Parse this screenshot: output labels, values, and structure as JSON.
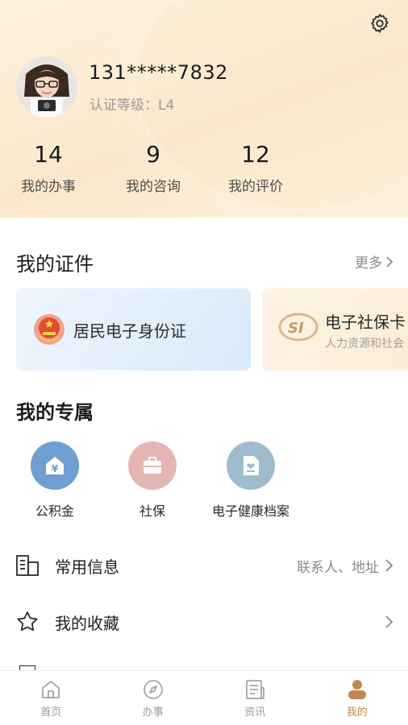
{
  "profile": {
    "phone": "131*****7832",
    "level_text": "认证等级：L4"
  },
  "stats": [
    {
      "value": "14",
      "label": "我的办事"
    },
    {
      "value": "9",
      "label": "我的咨询"
    },
    {
      "value": "12",
      "label": "我的评价"
    }
  ],
  "certificates": {
    "title": "我的证件",
    "more_label": "更多",
    "cards": [
      {
        "label": "居民电子身份证"
      },
      {
        "label": "电子社保卡",
        "sub": "人力资源和社会"
      }
    ]
  },
  "exclusive": {
    "title": "我的专属",
    "items": [
      {
        "label": "公积金",
        "color": "#6f9ed3"
      },
      {
        "label": "社保",
        "color": "#e3b6b2"
      },
      {
        "label": "电子健康档案",
        "color": "#9fbccd"
      }
    ]
  },
  "list": [
    {
      "label": "常用信息",
      "trail": "联系人、地址"
    },
    {
      "label": "我的收藏",
      "trail": ""
    }
  ],
  "tabs": [
    {
      "label": "首页"
    },
    {
      "label": "办事"
    },
    {
      "label": "资讯"
    },
    {
      "label": "我的"
    }
  ],
  "colors": {
    "accent": "#c2874f",
    "header_bg": "#fbe8cb"
  }
}
